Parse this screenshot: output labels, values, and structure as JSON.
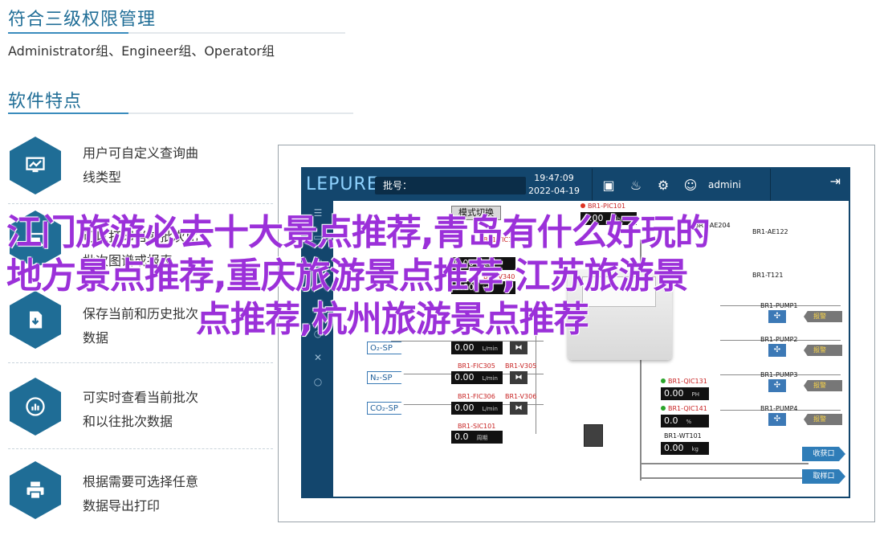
{
  "section1": {
    "title": "符合三级权限管理",
    "subtitle": "Administrator组、Engineer组、Operator组"
  },
  "section2": {
    "title": "软件特点"
  },
  "features": [
    {
      "icon": "monitor-chart-icon",
      "line1": "用户可自定义查询曲",
      "line2": "线类型"
    },
    {
      "icon": "report-icon",
      "line1": "可以打印当前批次比",
      "line2": "批次图谱或报表"
    },
    {
      "icon": "document-save-icon",
      "line1": "保存当前和历史批次",
      "line2": "数据"
    },
    {
      "icon": "realtime-chart-icon",
      "line1": "可实时查看当前批次",
      "line2": "和以往批次数据"
    },
    {
      "icon": "printer-icon",
      "line1": "根据需要可选择任意",
      "line2": "数据导出打印"
    }
  ],
  "hmi": {
    "logo": "LEPURE",
    "batch_label": "批号：",
    "time": "19:47:09",
    "date": "2022-04-19",
    "user": "admini",
    "mode_button": "模式切换",
    "tags": {
      "pic101": "BR1-PIC101",
      "pic101_val": "0.00",
      "pic101_unit": "mbar",
      "tic121": "BR1-TIC121",
      "tic121_val": "0.00",
      "tic121_unit": "°C",
      "tic_sv": "0.00",
      "tic_sv_unit": "°C",
      "v340": "BR1-V340",
      "fic305": "BR1-FIC305",
      "v305": "BR1-V305",
      "fic306": "BR1-FIC306",
      "v306": "BR1-V306",
      "sic101": "BR1-SIC101",
      "sic101_val": "0.0",
      "sic101_unit": "周期",
      "qic131": "BR1-QIC131",
      "qic131_val": "0.00",
      "qic131_unit": "PH",
      "qic141": "BR1-QIC141",
      "qic141_val": "0.0",
      "qic141_unit": "%",
      "wt101": "BR1-WT101",
      "wt101_val": "0.00",
      "wt101_unit": "kg",
      "flow_val": "0.00",
      "flow_unit": "L/min"
    },
    "gases": [
      "O₂-SP",
      "N₂-SP",
      "CO₂-SP"
    ],
    "pumps": [
      "BR1-PUMP1",
      "BR1-PUMP2",
      "BR1-PUMP3",
      "BR1-PUMP4"
    ],
    "alarm_text": "报警",
    "right_tags": [
      "BR1-AE204",
      "BR1-AE122",
      "BR1-T121"
    ],
    "harvest": "收获口",
    "sample": "取样口"
  },
  "overlay": {
    "line1": "江门旅游必去十大景点推荐,青岛有什么好玩的",
    "line2": "地方景点推荐,重庆旅游景点推荐,江苏旅游景",
    "line3": "点推荐,杭州旅游景点推荐"
  }
}
